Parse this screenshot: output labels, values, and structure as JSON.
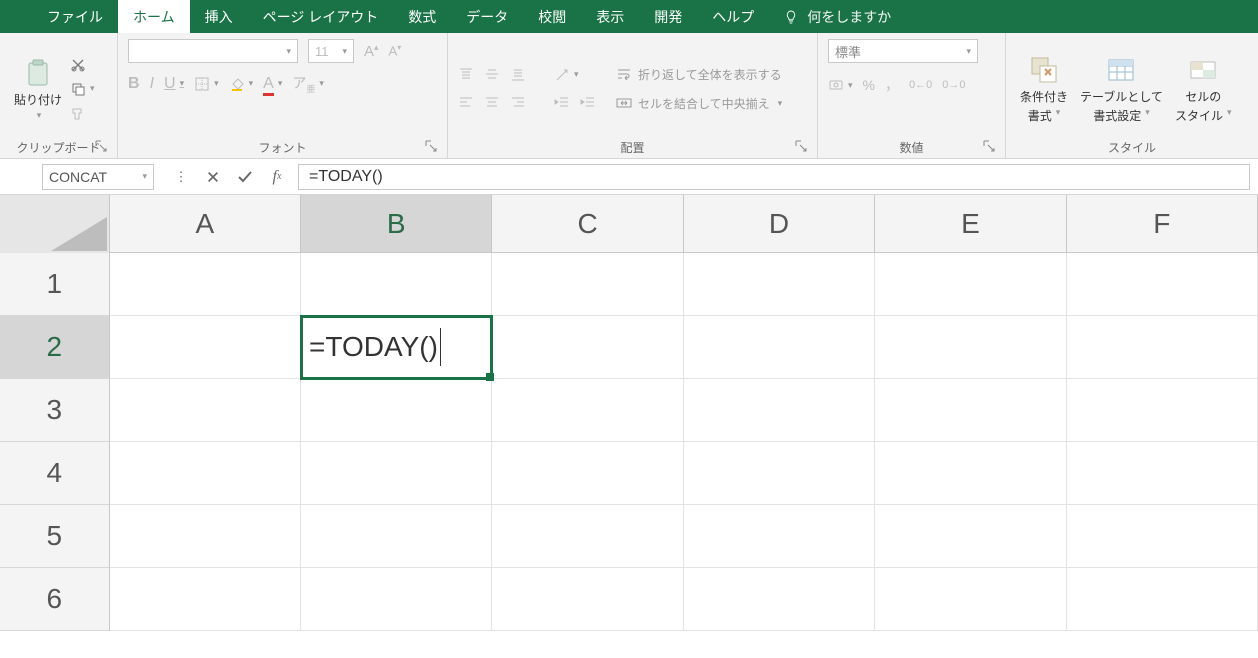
{
  "tabs": {
    "file": "ファイル",
    "home": "ホーム",
    "insert": "挿入",
    "layout": "ページ レイアウト",
    "formulas": "数式",
    "data": "データ",
    "review": "校閲",
    "view": "表示",
    "dev": "開発",
    "help": "ヘルプ",
    "tellme": "何をしますか"
  },
  "ribbon": {
    "clipboard": {
      "paste": "貼り付け",
      "label": "クリップボード"
    },
    "font": {
      "font_name": "",
      "font_size": "11",
      "bold": "B",
      "italic": "I",
      "underline": "U",
      "label": "フォント"
    },
    "alignment": {
      "wrap": "折り返して全体を表示する",
      "merge": "セルを結合して中央揃え",
      "label": "配置"
    },
    "number": {
      "format": "標準",
      "percent": "%",
      "comma": "，",
      "dec_inc": "0←0",
      "dec_dec": "0→0",
      "label": "数値"
    },
    "styles": {
      "cond": [
        "条件付き",
        "書式"
      ],
      "table": [
        "テーブルとして",
        "書式設定"
      ],
      "cell": [
        "セルの",
        "スタイル"
      ],
      "label": "スタイル"
    }
  },
  "formula_bar": {
    "name_box": "CONCAT",
    "formula": "=TODAY()"
  },
  "sheet": {
    "columns": [
      "A",
      "B",
      "C",
      "D",
      "E",
      "F"
    ],
    "rows": [
      "1",
      "2",
      "3",
      "4",
      "5",
      "6"
    ],
    "active_cell_display": "=TODAY()",
    "active": {
      "row": 1,
      "col": 1
    }
  }
}
